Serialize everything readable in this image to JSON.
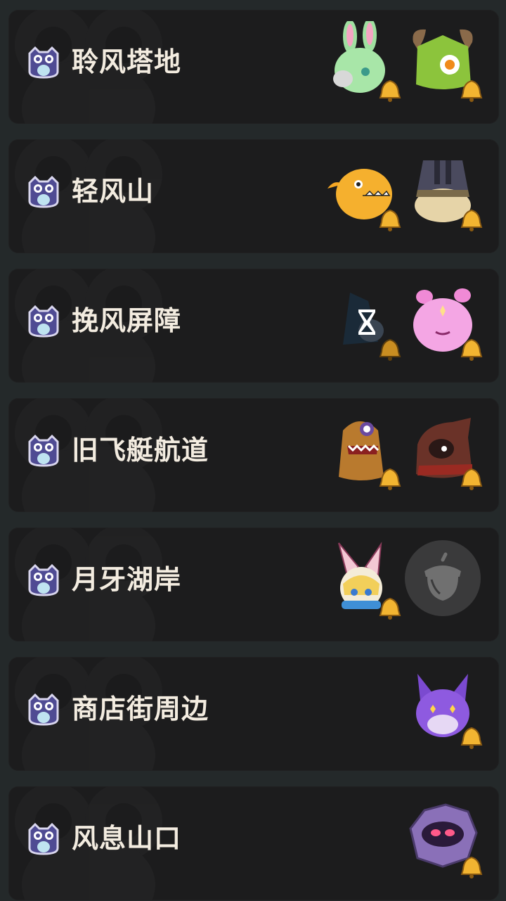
{
  "locations": [
    {
      "name": "聆风塔地",
      "pets": [
        "green-bunny-pet-icon",
        "green-horned-pet-icon"
      ]
    },
    {
      "name": "轻风山",
      "pets": [
        "orange-blob-pet-icon",
        "helmet-pet-icon"
      ]
    },
    {
      "name": "挽风屏障",
      "pets": [
        "hourglass-locked-pet-icon",
        "pink-blob-pet-icon"
      ]
    },
    {
      "name": "旧飞艇航道",
      "pets": [
        "brown-one-eyed-pet-icon",
        "red-cloak-pet-icon"
      ]
    },
    {
      "name": "月牙湖岸",
      "pets": [
        "fox-eared-pet-icon",
        "acorn-placeholder-icon"
      ]
    },
    {
      "name": "商店街周边",
      "pets": [
        "purple-cat-pet-icon"
      ]
    },
    {
      "name": "风息山口",
      "pets": [
        "rock-crab-pet-icon"
      ]
    }
  ],
  "colors": {
    "background": "#24292a",
    "card": "#1c1c1d",
    "text": "#f3ece0",
    "bell": "#f2b431",
    "owl_icon": "#4f4b93"
  }
}
